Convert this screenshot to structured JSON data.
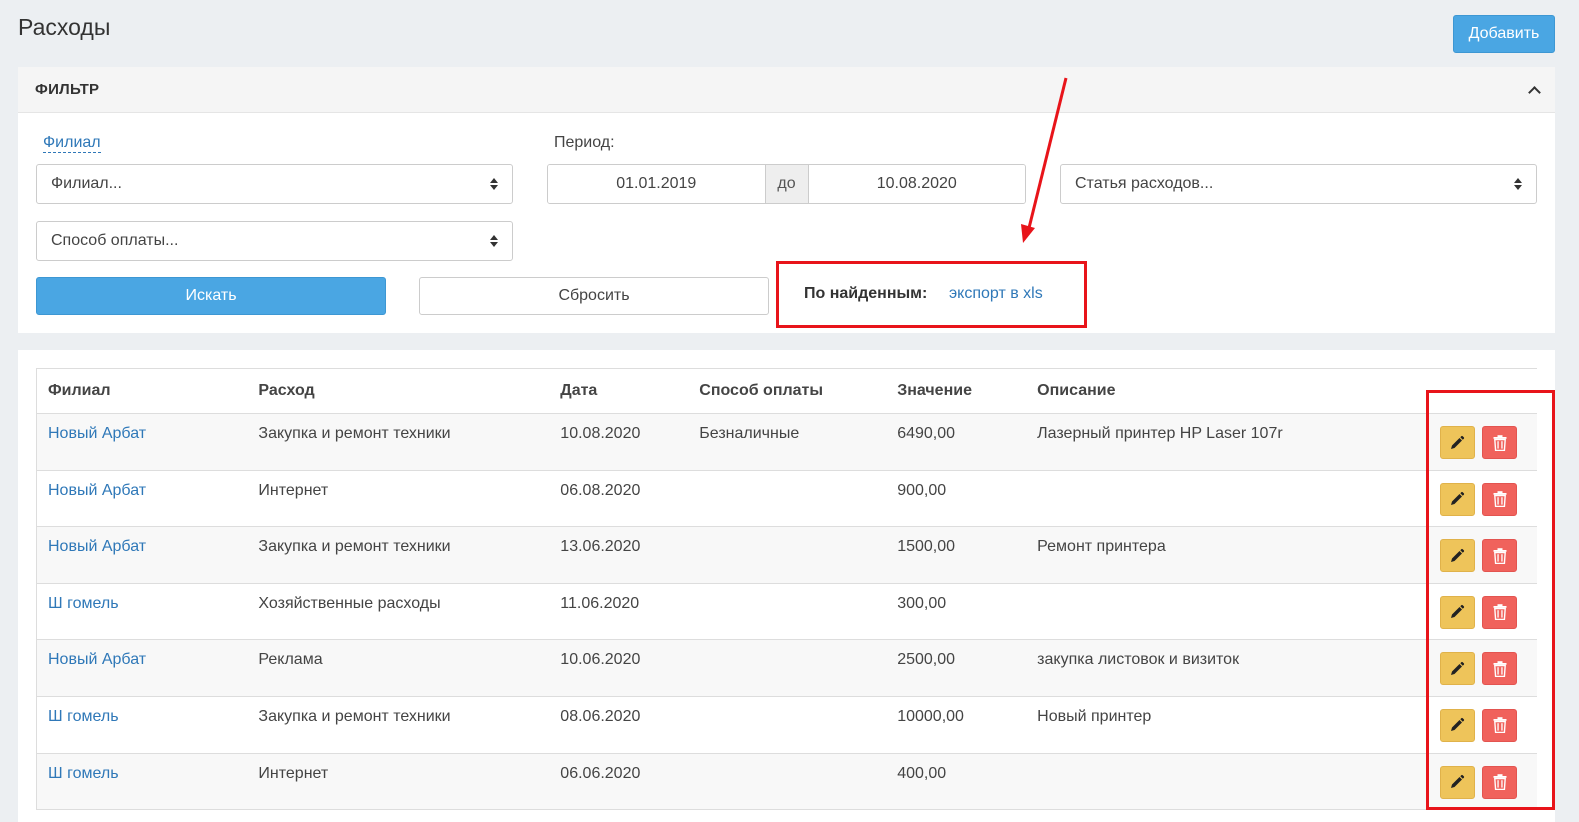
{
  "page": {
    "title": "Расходы",
    "add_label": "Добавить"
  },
  "filter": {
    "title": "ФИЛЬТР",
    "branch_label": "Филиал",
    "branch_select": "Филиал...",
    "period_label": "Период:",
    "date_from": "01.01.2019",
    "date_sep": "до",
    "date_to": "10.08.2020",
    "expense_item_select": "Статья расходов...",
    "payment_method_select": "Способ оплаты...",
    "search_label": "Искать",
    "reset_label": "Сбросить",
    "found_label": "По найденным:",
    "export_label": "экспорт в xls"
  },
  "table": {
    "columns": [
      "Филиал",
      "Расход",
      "Дата",
      "Способ оплаты",
      "Значение",
      "Описание"
    ],
    "rows": [
      {
        "branch": "Новый Арбат",
        "expense": "Закупка и ремонт техники",
        "date": "10.08.2020",
        "payment": "Безналичные",
        "value": "6490,00",
        "description": "Лазерный принтер HP Laser 107r"
      },
      {
        "branch": "Новый Арбат",
        "expense": "Интернет",
        "date": "06.08.2020",
        "payment": "",
        "value": "900,00",
        "description": ""
      },
      {
        "branch": "Новый Арбат",
        "expense": "Закупка и ремонт техники",
        "date": "13.06.2020",
        "payment": "",
        "value": "1500,00",
        "description": "Ремонт принтера"
      },
      {
        "branch": "Ш гомель",
        "expense": "Хозяйственные расходы",
        "date": "11.06.2020",
        "payment": "",
        "value": "300,00",
        "description": ""
      },
      {
        "branch": "Новый Арбат",
        "expense": "Реклама",
        "date": "10.06.2020",
        "payment": "",
        "value": "2500,00",
        "description": "закупка листовок и визиток"
      },
      {
        "branch": "Ш гомель",
        "expense": "Закупка и ремонт техники",
        "date": "08.06.2020",
        "payment": "",
        "value": "10000,00",
        "description": "Новый принтер"
      },
      {
        "branch": "Ш гомель",
        "expense": "Интернет",
        "date": "06.06.2020",
        "payment": "",
        "value": "400,00",
        "description": ""
      }
    ]
  },
  "colors": {
    "primary": "#4aa6e3",
    "link": "#2f78b8",
    "edit": "#eec45a",
    "delete": "#f0625c",
    "annotation": "#e8141a"
  },
  "icons": {
    "edit": "pencil-icon",
    "delete": "trash-icon",
    "collapse": "chevron-up-icon",
    "select": "sort-arrows-icon"
  }
}
